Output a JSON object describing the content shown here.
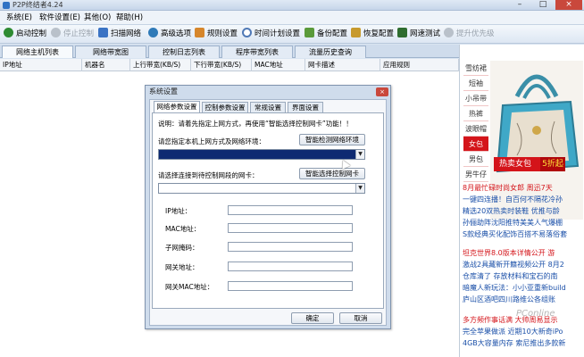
{
  "app": {
    "title": "P2P终结者4.24"
  },
  "window_controls": {
    "minimize": "–",
    "maximize": "□",
    "close": "×"
  },
  "menu": [
    "系统(E)",
    "软件设置(E)",
    "其他(O)",
    "帮助(H)"
  ],
  "toolbar": [
    {
      "label": "启动控制",
      "icon": "play-icon",
      "color": "#2e8b32",
      "disabled": false
    },
    {
      "label": "停止控制",
      "icon": "stop-icon",
      "color": "#b9c1ca",
      "disabled": true
    },
    {
      "label": "扫描网络",
      "icon": "scan-icon",
      "color": "#3a73c4",
      "disabled": false
    },
    {
      "label": "高级选项",
      "icon": "advanced-icon",
      "color": "#2f7ab8",
      "disabled": false
    },
    {
      "label": "规则设置",
      "icon": "rules-icon",
      "color": "#d6862b",
      "disabled": false
    },
    {
      "label": "时间计划设置",
      "icon": "clock-icon",
      "color": "#4f79b6",
      "disabled": false
    },
    {
      "label": "备份配置",
      "icon": "backup-icon",
      "color": "#5a9a3a",
      "disabled": false
    },
    {
      "label": "恢复配置",
      "icon": "restore-icon",
      "color": "#c79a2d",
      "disabled": false
    },
    {
      "label": "网速测试",
      "icon": "speed-test-icon",
      "color": "#2f6d2f",
      "disabled": false
    },
    {
      "label": "提升优先级",
      "icon": "priority-icon",
      "color": "#b9c1ca",
      "disabled": true
    }
  ],
  "main_tabs": [
    "网络主机列表",
    "网络带宽图",
    "控制日志列表",
    "程序带宽列表",
    "流量历史查询"
  ],
  "table_columns": [
    "IP地址",
    "机器名",
    "上行带宽(KB/S)",
    "下行带宽(KB/S)",
    "MAC地址",
    "网卡描述",
    "应用规则"
  ],
  "ad": {
    "nav": [
      "雪纺裙",
      "短袖",
      "小吊带",
      "热裤",
      "波眼帽",
      "女包",
      "男包",
      "男牛仔"
    ],
    "banner_text": "热卖女包",
    "banner_pct": "5折起"
  },
  "news": [
    {
      "text": "8月最忙碌时尚女郎  周迅7天",
      "style": "red"
    },
    {
      "text": "一键四连播！自百何不隔花冷孙",
      "style": "blue"
    },
    {
      "text": "精选20双热卖时装鞋  优推与龄",
      "style": "blue"
    },
    {
      "text": "孙俪助阵沈阳推特美美人气爆棚",
      "style": "blue"
    },
    {
      "text": "S款经典买化配饰百搭不易落俗套",
      "style": "blue"
    },
    {
      "text": "坦克世界8.0版本详情公开  游",
      "style": "red"
    },
    {
      "text": "激战2具藏新开籍视频公开  8月2",
      "style": "blue"
    },
    {
      "text": "仓库清了  存放材料和宝石的南",
      "style": "blue"
    },
    {
      "text": "暗魔人新玩法：小小亚重新build",
      "style": "blue"
    },
    {
      "text": "庐山区酒吧四川路维公各组账",
      "style": "blue"
    },
    {
      "text": "多方频作事话满  大帅周易显示",
      "style": "red"
    },
    {
      "text": "完全苹果做派  近期10大新奇iPo",
      "style": "blue"
    },
    {
      "text": "4GB大容量内存  索尼推出多款新",
      "style": "blue"
    }
  ],
  "watermark": "PConline",
  "dialog": {
    "title": "系统设置",
    "close": "×",
    "tabs": [
      "网络参数设置",
      "控制参数设置",
      "常规设置",
      "界面设置"
    ],
    "note": "说明：请着先指定上网方式，再使用“智能选择控制网卡”功能！！",
    "env_label": "请您指定本机上网方式及网络环境：",
    "env_detect_button": "智能检测网络环境",
    "nic_label": "请选择连接到待控制网段的网卡：",
    "nic_select_button": "智能选择控制网卡",
    "fields": [
      "IP地址：",
      "MAC地址：",
      "子网掩码：",
      "网关地址：",
      "网关MAC地址："
    ],
    "ok": "确定",
    "cancel": "取消"
  }
}
